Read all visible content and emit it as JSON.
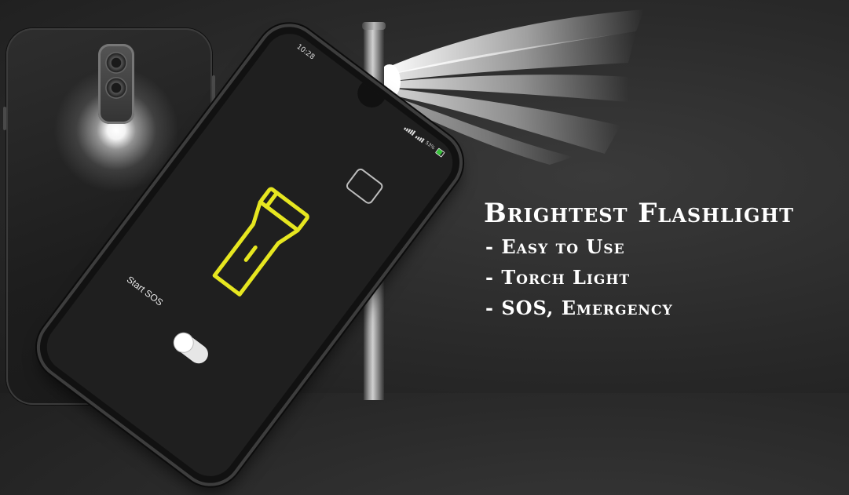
{
  "status_bar": {
    "time": "10:28",
    "battery_percent": "53%",
    "battery_color": "#36c23a"
  },
  "app": {
    "sos_label": "Start SOS",
    "sos_toggle_on": false,
    "torch_icon": "flashlight-icon",
    "accent_color": "#e6e620"
  },
  "promo": {
    "headline": "Brightest Flashlight",
    "features": [
      "- Easy to Use",
      "- Torch Light",
      "- SOS, Emergency"
    ]
  }
}
